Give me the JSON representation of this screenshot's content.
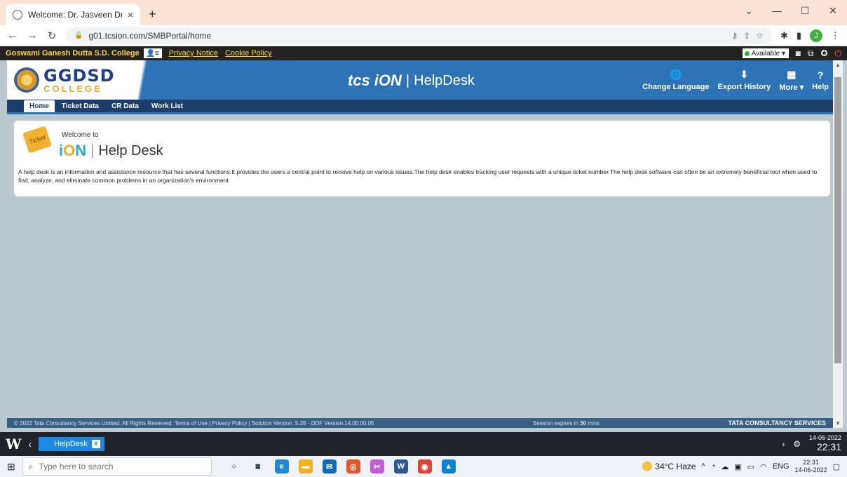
{
  "browser": {
    "tab_title": "Welcome: Dr. Jasveen Dua",
    "tab_close": "×",
    "new_tab": "+",
    "url": "g01.tcsion.com/SMBPortal/home",
    "window_controls": [
      "⌄",
      "—",
      "☐",
      "✕"
    ],
    "profile_initial": "J"
  },
  "strip": {
    "college_name": "Goswami Ganesh Dutta S.D. College",
    "privacy_link": "Privacy Notice",
    "cookie_link": "Cookie Policy",
    "status": "Available"
  },
  "header": {
    "logo_main": "GGDSD",
    "logo_sub": "COLLEGE",
    "brand_tcs": "tcs",
    "brand_ion": "iON",
    "brand_sep": "|",
    "brand_name": "HelpDesk",
    "actions": [
      {
        "label": "Change Language",
        "icon": "globe-icon"
      },
      {
        "label": "Export History",
        "icon": "download-icon"
      },
      {
        "label": "More ▾",
        "icon": "grid-icon"
      },
      {
        "label": "Help",
        "icon": "help-icon"
      }
    ]
  },
  "nav": {
    "tabs": [
      "Home",
      "Ticket Data",
      "CR Data",
      "Work List"
    ],
    "active": "Home"
  },
  "welcome": {
    "ticket_label": "Ticket",
    "welcome_to": "Welcome to",
    "ion_prefix": "i",
    "ion_o": "O",
    "ion_suffix": "N",
    "sep": "|",
    "title": "Help Desk",
    "description": "A help desk is an information and assistance resource that has several functions.It provides the users a central point to receive help on various issues.The help desk enables tracking user requests with a unique ticket number.The help desk software can often be an extremely beneficial tool when used to find, analyze, and eliminate common problems in an organization's environment."
  },
  "footer": {
    "copyright": "© 2022 Tata Consultancy Services Limited. All Rights Reserved.   Terms of Use | Privacy Policy | Solution Version :5.26 - DDF Version:14.00.00.05",
    "session_prefix": "Session expires in ",
    "session_mins": "30",
    "session_suffix": " mins",
    "company": "TATA CONSULTANCY SERVICES"
  },
  "app_taskbar": {
    "logo": "W",
    "tab_label": "HelpDesk",
    "tab_close": "x",
    "date": "14-06-2022",
    "time": "22:31"
  },
  "win_taskbar": {
    "search_placeholder": "Type here to search",
    "weather": "34°C Haze",
    "lang": "ENG",
    "time": "22:31",
    "date": "14-06-2022"
  },
  "colors": {
    "header_blue": "#2f73b7",
    "nav_dark": "#1d3e6b",
    "strip_link": "#ffd23a",
    "content_bg": "#b9c9cf"
  }
}
